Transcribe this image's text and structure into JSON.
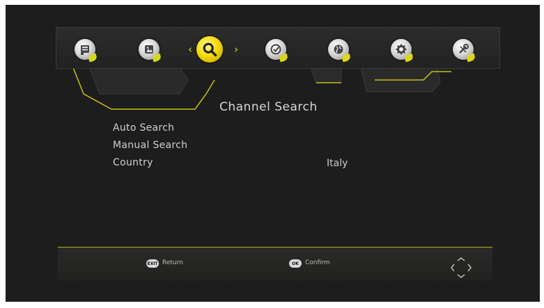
{
  "menu": {
    "tabs": [
      {
        "icon": "program-icon"
      },
      {
        "icon": "picture-icon"
      },
      {
        "icon": "search-icon",
        "active": true
      },
      {
        "icon": "time-icon"
      },
      {
        "icon": "globe-icon"
      },
      {
        "icon": "gear-icon"
      },
      {
        "icon": "tools-icon"
      }
    ],
    "accent_color": "#d9d71a"
  },
  "page": {
    "title": "Channel Search",
    "items": [
      {
        "label": "Auto Search",
        "value": ""
      },
      {
        "label": "Manual Search",
        "value": ""
      },
      {
        "label": "Country",
        "value": "Italy"
      }
    ]
  },
  "footer": {
    "return_key": "EXIT",
    "return_label": "Return",
    "confirm_key": "OK",
    "confirm_label": "Confirm",
    "nav_icon": "directional-pad-icon"
  }
}
